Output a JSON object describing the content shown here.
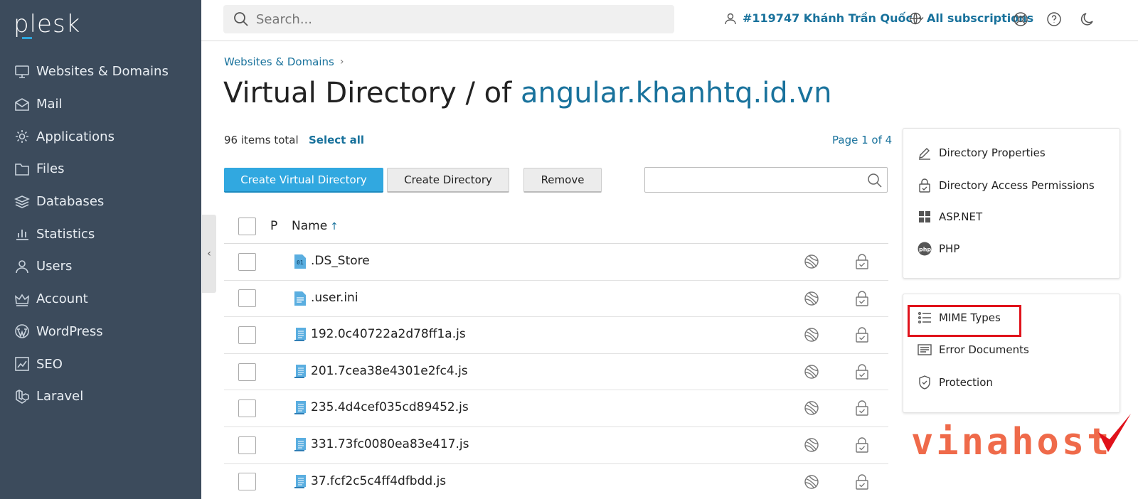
{
  "sidebar": {
    "logo": "plesk",
    "items": [
      {
        "label": "Websites & Domains",
        "icon": "monitor-icon"
      },
      {
        "label": "Mail",
        "icon": "mail-icon"
      },
      {
        "label": "Applications",
        "icon": "gear-icon"
      },
      {
        "label": "Files",
        "icon": "folder-icon"
      },
      {
        "label": "Databases",
        "icon": "layers-icon"
      },
      {
        "label": "Statistics",
        "icon": "bar-chart-icon"
      },
      {
        "label": "Users",
        "icon": "user-icon"
      },
      {
        "label": "Account",
        "icon": "crown-icon"
      },
      {
        "label": "WordPress",
        "icon": "wordpress-icon"
      },
      {
        "label": "SEO",
        "icon": "seo-chart-icon"
      },
      {
        "label": "Laravel",
        "icon": "laravel-icon"
      }
    ]
  },
  "topbar": {
    "search_placeholder": "Search...",
    "user_label": "#119747 Khánh Trần Quốc",
    "subscriptions_label": "All subscriptions"
  },
  "main": {
    "breadcrumb": "Websites & Domains",
    "title_prefix": "Virtual Directory / of ",
    "title_link": "angular.khanhtq.id.vn",
    "items_total": "96 items total",
    "select_all": "Select all",
    "page_info": "Page 1 of 4",
    "buttons": {
      "create_virtual_directory": "Create Virtual Directory",
      "create_directory": "Create Directory",
      "remove": "Remove"
    },
    "table": {
      "col_p": "P",
      "col_name": "Name",
      "sort_arrow": "↑",
      "rows": [
        {
          "name": ".DS_Store",
          "icon": "binary-file-icon"
        },
        {
          "name": ".user.ini",
          "icon": "text-file-icon"
        },
        {
          "name": "192.0c40722a2d78ff1a.js",
          "icon": "script-file-icon"
        },
        {
          "name": "201.7cea38e4301e2fc4.js",
          "icon": "script-file-icon"
        },
        {
          "name": "235.4d4cef035cd89452.js",
          "icon": "script-file-icon"
        },
        {
          "name": "331.73fc0080ea83e417.js",
          "icon": "script-file-icon"
        },
        {
          "name": "37.fcf2c5c4ff4dfbdd.js",
          "icon": "script-file-icon"
        }
      ]
    }
  },
  "right_panel": {
    "group1": [
      {
        "label": "Directory Properties",
        "icon": "pencil-icon"
      },
      {
        "label": "Directory Access Permissions",
        "icon": "lock-icon"
      },
      {
        "label": "ASP.NET",
        "icon": "windows-icon"
      },
      {
        "label": "PHP",
        "icon": "php-icon"
      }
    ],
    "group2": [
      {
        "label": "MIME Types",
        "icon": "list-icon"
      },
      {
        "label": "Error Documents",
        "icon": "document-icon"
      },
      {
        "label": "Protection",
        "icon": "shield-icon"
      }
    ]
  },
  "watermark": "vinahost",
  "colors": {
    "sidebar_bg": "#3c4b5c",
    "link": "#19729c",
    "primary_button": "#31a8e0",
    "highlight_box": "#e0121b",
    "watermark": "#ef6a4a"
  }
}
